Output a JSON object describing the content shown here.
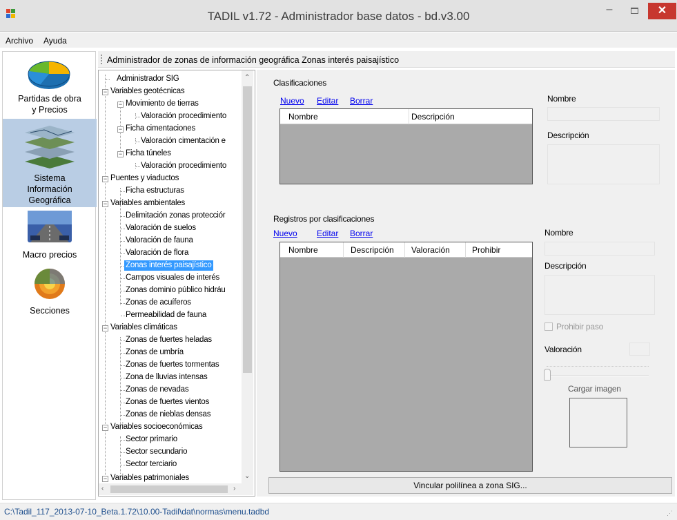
{
  "window": {
    "title": "TADIL v1.72 - Administrador base datos - bd.v3.00",
    "minimize_glyph": "–",
    "close_glyph": "✕"
  },
  "menu": [
    "Archivo",
    "Ayuda"
  ],
  "sidebar": {
    "items": [
      {
        "label_line1": "Partidas de obra",
        "label_line2": "y Precios",
        "icon": "pie-chart-icon"
      },
      {
        "label_line1": "Sistema",
        "label_line2": "Información",
        "label_line3": "Geográfica",
        "icon": "gis-layers-icon",
        "active": true
      },
      {
        "label_line1": "Macro precios",
        "icon": "road-navigation-icon"
      },
      {
        "label_line1": "Secciones",
        "icon": "earth-section-icon"
      }
    ]
  },
  "header": {
    "text": "Administrador de zonas de información geográfica  Zonas interés paisajístico"
  },
  "tree": {
    "nodes": [
      "Administrador SIG",
      "Variables geotécnicas",
      "Movimiento de tierras",
      "Valoración procedimiento",
      "Ficha cimentaciones",
      "Valoración cimentación e",
      "Ficha túneles",
      "Valoración procedimiento",
      "Puentes y viaductos",
      "Ficha estructuras",
      "Variables ambientales",
      "Delimitación zonas protecciór",
      "Valoración de suelos",
      "Valoración de fauna",
      "Valoración de flora",
      "Zonas interés paisajístico",
      "Campos visuales de interés",
      "Zonas dominio público hidráu",
      "Zonas de acuíferos",
      "Permeabilidad de fauna",
      "Variables climáticas",
      "Zonas de fuertes heladas",
      "Zonas de umbría",
      "Zonas de fuertes tormentas",
      "Zona de lluvias intensas",
      "Zonas de nevadas",
      "Zonas de fuertes vientos",
      "Zonas de nieblas densas",
      "Variables socioeconómicas",
      "Sector primario",
      "Sector secundario",
      "Sector terciario",
      "Variables patrimoniales"
    ],
    "expander_glyph": "−",
    "selected": "Zonas interés paisajístico"
  },
  "clasificaciones": {
    "title": "Clasificaciones",
    "actions": {
      "new": "Nuevo",
      "edit": "Editar",
      "delete": "Borrar"
    },
    "columns": [
      "Nombre",
      "Descripción"
    ],
    "form": {
      "name_label": "Nombre",
      "desc_label": "Descripción"
    }
  },
  "registros": {
    "title": "Registros por clasificaciones",
    "actions": {
      "new": "Nuevo",
      "edit": "Editar",
      "delete": "Borrar"
    },
    "columns": [
      "Nombre",
      "Descripción",
      "Valoración",
      "Prohibir"
    ],
    "form": {
      "name_label": "Nombre",
      "desc_label": "Descripción",
      "prohibit_label": "Prohibir paso",
      "valoracion_label": "Valoración",
      "load_image_label": "Cargar imagen"
    }
  },
  "link_button": "Vincular polilínea a zona SIG...",
  "status": {
    "path": "C:\\Tadil_117_2013-07-10_Beta.1.72\\10.00-Tadil\\dat\\normas\\menu.tadbd"
  }
}
